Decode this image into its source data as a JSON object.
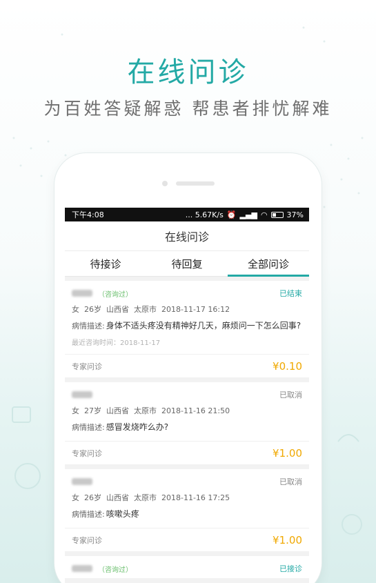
{
  "hero": {
    "title": "在线问诊",
    "subtitle": "为百姓答疑解惑  帮患者排忧解难"
  },
  "statusbar": {
    "time": "下午4:08",
    "speed": "... 5.67K/s",
    "battery": "37%"
  },
  "app": {
    "nav_title": "在线问诊",
    "tabs": [
      {
        "label": "待接诊",
        "active": false
      },
      {
        "label": "待回复",
        "active": false
      },
      {
        "label": "全部问诊",
        "active": true
      }
    ]
  },
  "labels": {
    "desc_label": "病情描述:",
    "expert_label": "专家问诊"
  },
  "cards": [
    {
      "tag": "（咨询过）",
      "status": "已结束",
      "gender": "女",
      "age": "26岁",
      "province": "山西省",
      "city": "太原市",
      "datetime": "2018-11-17 16:12",
      "description": "身体不适头疼没有精神好几天，麻烦问一下怎么回事?",
      "last_consult": "最近咨询时间：2018-11-17",
      "price": "¥0.10"
    },
    {
      "tag": "",
      "status": "已取消",
      "gender": "女",
      "age": "27岁",
      "province": "山西省",
      "city": "太原市",
      "datetime": "2018-11-16 21:50",
      "description": "感冒发烧咋么办?",
      "last_consult": "",
      "price": "¥1.00"
    },
    {
      "tag": "",
      "status": "已取消",
      "gender": "女",
      "age": "26岁",
      "province": "山西省",
      "city": "太原市",
      "datetime": "2018-11-16 17:25",
      "description": "咳嗽头疼",
      "last_consult": "",
      "price": "¥1.00"
    },
    {
      "tag": "（咨询过）",
      "status": "已接诊"
    }
  ],
  "colors": {
    "accent": "#23a9a5",
    "price": "#f0a800",
    "tag": "#6bbf6e"
  }
}
